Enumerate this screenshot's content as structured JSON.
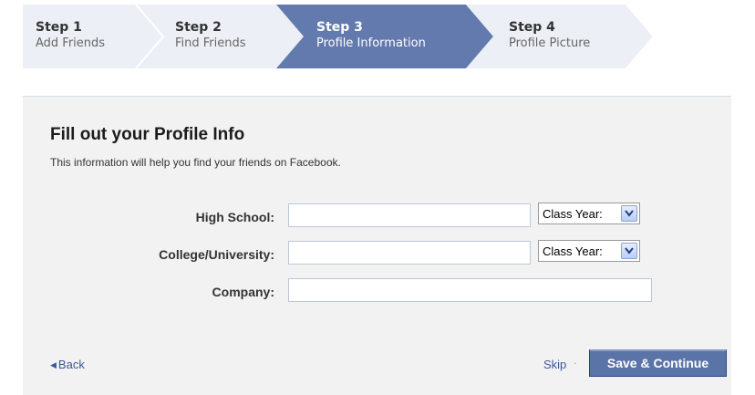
{
  "steps": [
    {
      "title": "Step 1",
      "subtitle": "Add Friends"
    },
    {
      "title": "Step 2",
      "subtitle": "Find Friends"
    },
    {
      "title": "Step 3",
      "subtitle": "Profile Information",
      "active": true
    },
    {
      "title": "Step 4",
      "subtitle": "Profile Picture"
    }
  ],
  "form": {
    "heading": "Fill out your Profile Info",
    "subheading": "This information will help you find your friends on Facebook.",
    "high_school": {
      "label": "High School:",
      "value": ""
    },
    "college": {
      "label": "College/University:",
      "value": ""
    },
    "company": {
      "label": "Company:",
      "value": ""
    },
    "class_year_select": "Class Year:"
  },
  "footer": {
    "back_label": "Back",
    "back_icon": "left-triangle-icon",
    "skip_label": "Skip",
    "separator": "·",
    "save_label": "Save & Continue"
  },
  "colors": {
    "active_step": "#627aad",
    "inactive_step": "#eceff5",
    "panel_bg": "#f2f2f2",
    "link": "#3b5998",
    "primary_button": "#5b74a8"
  }
}
